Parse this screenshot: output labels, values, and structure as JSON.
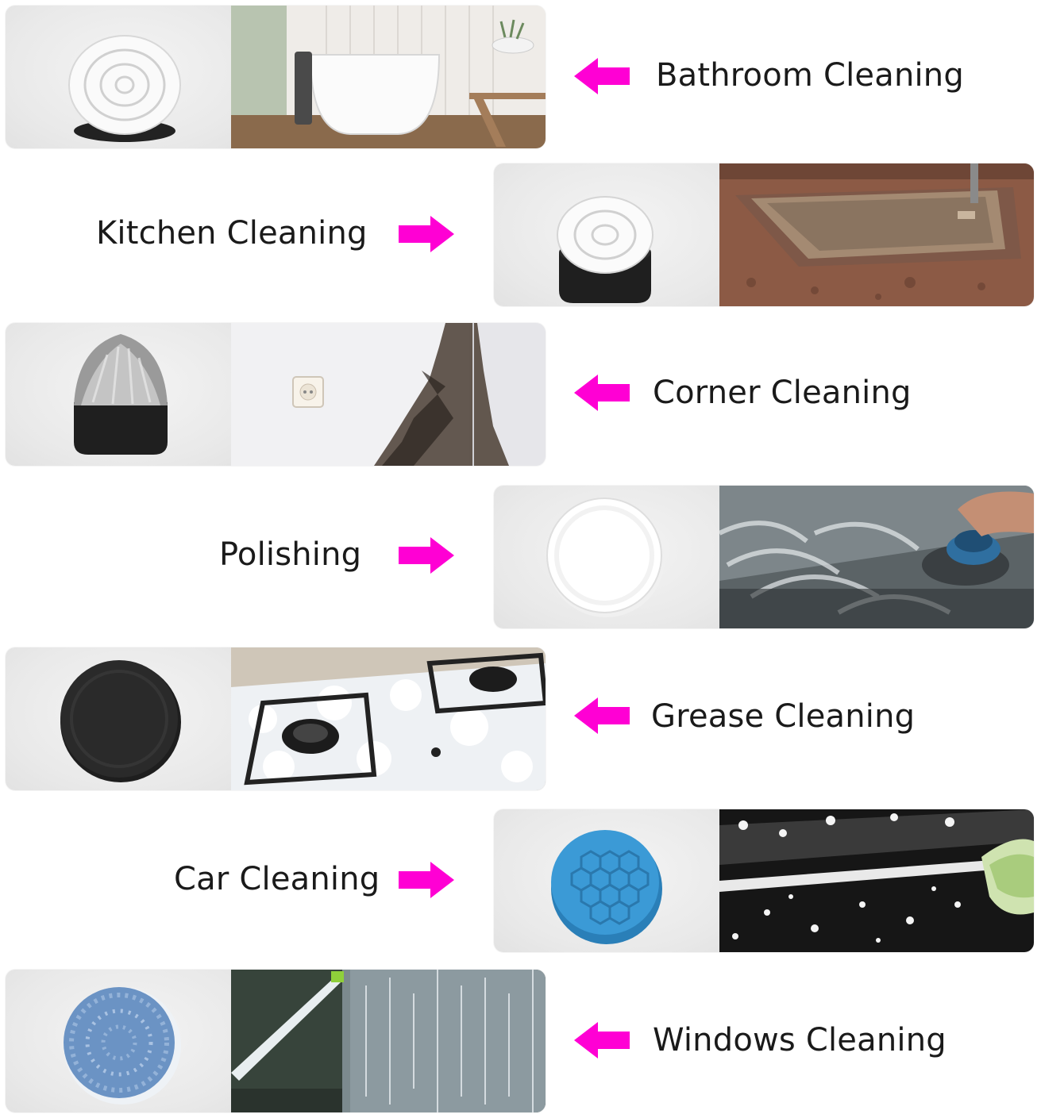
{
  "accent_color": "#ff00d4",
  "rows": [
    {
      "label": "Bathroom Cleaning",
      "arrow": "left-arrow-icon",
      "tool": "round-bristle-brush-icon",
      "scene": "bathroom-bathtub-photo"
    },
    {
      "label": "Kitchen Cleaning",
      "arrow": "right-arrow-icon",
      "tool": "bristle-brush-icon",
      "scene": "kitchen-sink-photo"
    },
    {
      "label": "Corner Cleaning",
      "arrow": "left-arrow-icon",
      "tool": "cone-brush-icon",
      "scene": "moldy-wall-corner-photo"
    },
    {
      "label": "Polishing",
      "arrow": "right-arrow-icon",
      "tool": "white-polishing-pad-icon",
      "scene": "polishing-machine-photo"
    },
    {
      "label": "Grease Cleaning",
      "arrow": "left-arrow-icon",
      "tool": "black-scouring-pad-icon",
      "scene": "gas-stove-foam-photo"
    },
    {
      "label": "Car Cleaning",
      "arrow": "right-arrow-icon",
      "tool": "blue-hexagon-sponge-icon",
      "scene": "car-wash-foam-photo"
    },
    {
      "label": "Windows Cleaning",
      "arrow": "left-arrow-icon",
      "tool": "microfiber-pad-icon",
      "scene": "window-glass-photo"
    }
  ]
}
